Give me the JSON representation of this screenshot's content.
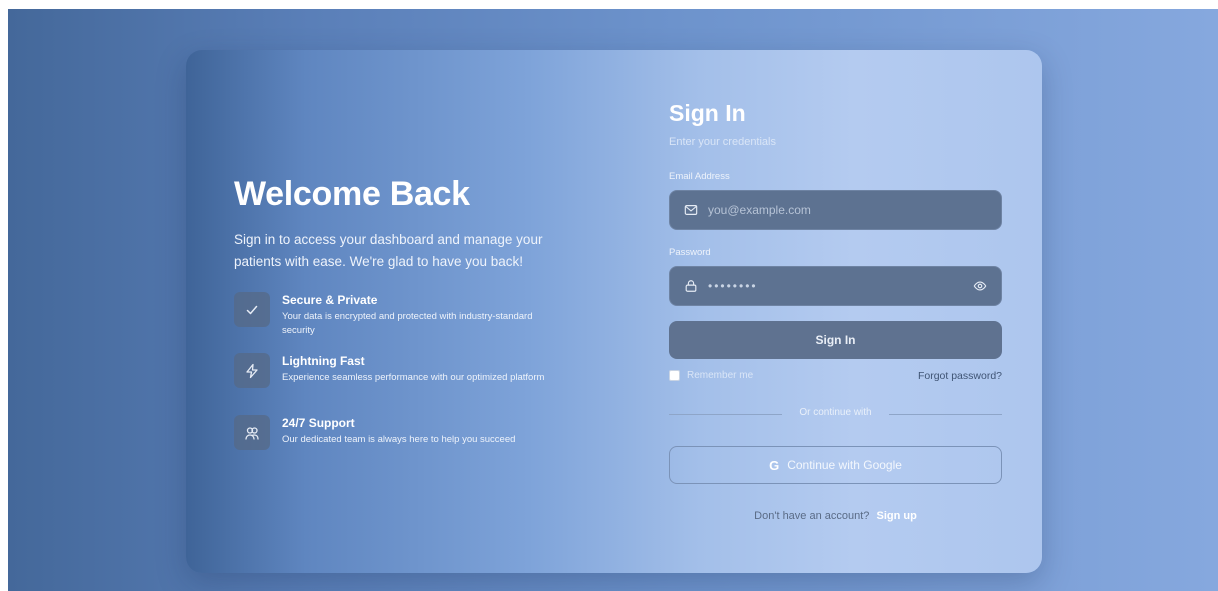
{
  "left": {
    "title": "Welcome Back",
    "subtitle": "Sign in to access your dashboard and manage your patients with ease. We're glad to have you back!",
    "features": [
      {
        "icon": "check-icon",
        "title": "Secure & Private",
        "desc": "Your data is encrypted and protected with industry-standard security"
      },
      {
        "icon": "lightning-icon",
        "title": "Lightning Fast",
        "desc": "Experience seamless performance with our optimized platform"
      },
      {
        "icon": "support-icon",
        "title": "24/7 Support",
        "desc": "Our dedicated team is always here to help you succeed"
      }
    ]
  },
  "form": {
    "title": "Sign In",
    "subtitle": "Enter your credentials",
    "email": {
      "label": "Email Address",
      "placeholder": "you@example.com",
      "icon": "mail-icon"
    },
    "password": {
      "label": "Password",
      "value": "••••••••",
      "icon": "lock-icon",
      "toggle_icon": "eye-icon"
    },
    "submit_label": "Sign In",
    "remember_label": "Remember me",
    "forgot_label": "Forgot password?",
    "divider_label": "Or continue with",
    "google_letter": "G",
    "google_label": "Continue with Google",
    "signup_prompt": "Don't have an account?",
    "signup_link": "Sign up"
  },
  "colors": {
    "accent_dark": "#44689a",
    "accent_light": "#b4cbf0",
    "input_bg": "#5d7291"
  }
}
